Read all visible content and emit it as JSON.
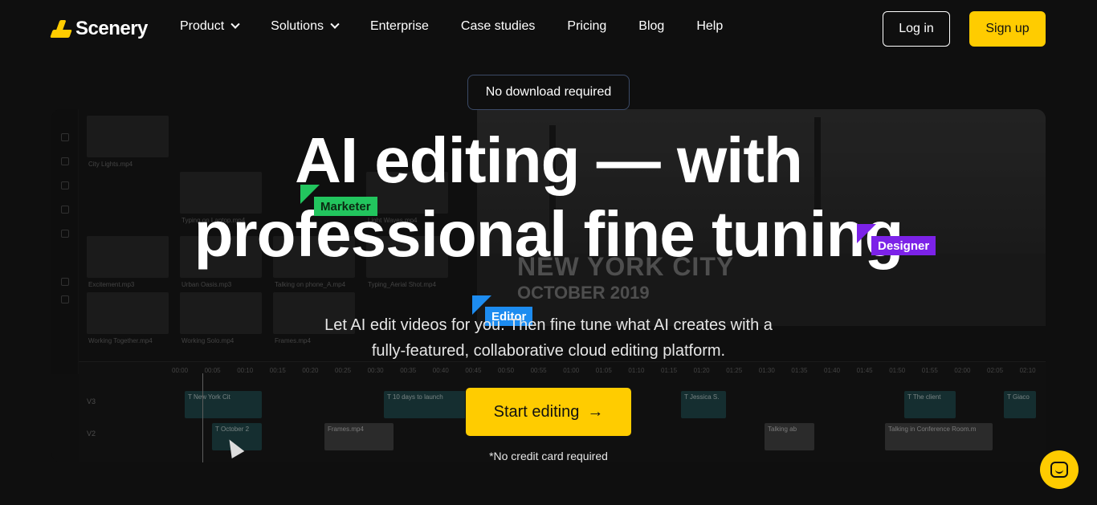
{
  "brand": {
    "name": "Scenery",
    "accent": "#ffcc00"
  },
  "nav": {
    "items": [
      {
        "label": "Product",
        "dropdown": true
      },
      {
        "label": "Solutions",
        "dropdown": true
      },
      {
        "label": "Enterprise",
        "dropdown": false
      },
      {
        "label": "Case studies",
        "dropdown": false
      },
      {
        "label": "Pricing",
        "dropdown": false
      },
      {
        "label": "Blog",
        "dropdown": false
      },
      {
        "label": "Help",
        "dropdown": false
      }
    ],
    "login": "Log in",
    "signup": "Sign up"
  },
  "hero": {
    "pill": "No download required",
    "title_line1": "AI editing — with",
    "title_line2": "professional fine tuning",
    "subtitle": "Let AI edit videos for you. Then fine tune what AI creates with a fully-featured, collaborative cloud editing platform.",
    "cta": "Start editing",
    "note": "*No credit card required",
    "tags": {
      "marketer": {
        "label": "Marketer",
        "color": "#22c55e"
      },
      "designer": {
        "label": "Designer",
        "color": "#7c22e8"
      },
      "editor": {
        "label": "Editor",
        "color": "#1d8cf0"
      }
    }
  },
  "editor_preview": {
    "thumbs": [
      "City Lights.mp4",
      "Excitement.mp3",
      "Working Together.mp4",
      "Typing on Laptop.mp4",
      "Urban Oasis.mp3",
      "Working Solo.mp4",
      "Talking on phone_A.mp4",
      "Frames.mp4",
      "Typing_Aerial Shot.mp4",
      "Light Waves.mp4"
    ],
    "overlay_title": "NEW YORK CITY",
    "overlay_sub": "OCTOBER 2019",
    "ruler": [
      "00:00",
      "00:05",
      "00:10",
      "00:15",
      "00:20",
      "00:25",
      "00:30",
      "00:35",
      "00:40",
      "00:45",
      "00:50",
      "00:55",
      "01:00",
      "01:05",
      "01:10",
      "01:15",
      "01:20",
      "01:25",
      "01:30",
      "01:35",
      "01:40",
      "01:45",
      "01:50",
      "01:55",
      "02:00",
      "02:05",
      "02:10"
    ],
    "tracks": [
      "V3",
      "V2"
    ],
    "clips": [
      {
        "label": "T New York Cit",
        "style": "teal"
      },
      {
        "label": "T 10 days to launch",
        "style": "teal"
      },
      {
        "label": "T Jessica S.",
        "style": "teal"
      },
      {
        "label": "T The client",
        "style": "teal"
      },
      {
        "label": "T Giaco",
        "style": "teal"
      },
      {
        "label": "T October 2",
        "style": "teal"
      },
      {
        "label": "Frames.mp4",
        "style": "grey"
      },
      {
        "label": "Talking ab",
        "style": "grey"
      },
      {
        "label": "Talking in Conference Room.m",
        "style": "grey"
      }
    ]
  },
  "icons": {
    "chevron": "chevron-down-icon",
    "arrow": "arrow-right-icon",
    "chat": "chat-bubble-icon",
    "cursor": "mouse-cursor-icon"
  }
}
